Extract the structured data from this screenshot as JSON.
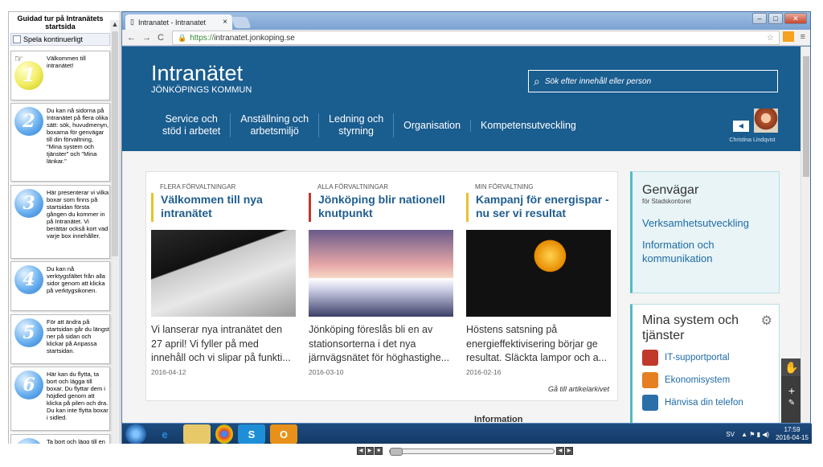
{
  "tour": {
    "title": "Guidad tur på Intranätets startsida",
    "loop_label": "Spela kontinuerligt",
    "steps": [
      {
        "num": "1",
        "text": "Välkommen till intranätet!"
      },
      {
        "num": "2",
        "text": "Du kan nå sidorna på Intranätet på flera olika sätt: sök, huvudmenyn, boxarna för genvägar till din förvaltning, \"Mina system och tjänster\" och \"Mina länkar.\""
      },
      {
        "num": "3",
        "text": "Här presenterar vi vilka boxar som finns på startsidan första gången du kommer in på Intranätet. Vi berättar också kort vad varje box innehåller."
      },
      {
        "num": "4",
        "text": "Du kan nå verktygsfältet från alla sidor genom att klicka på verktygsikonen."
      },
      {
        "num": "5",
        "text": "För att ändra på startsidan går du längst ner på sidan och klickar på Anpassa startsidan."
      },
      {
        "num": "6",
        "text": "Här kan du flytta, ta bort och lägga till boxar. Du flyttar dem i höjdled genom att klicka på pilen och dra. Du kan inte flytta boxar i sidled."
      },
      {
        "num": "7",
        "text": "Ta bort och lägg till en modul."
      }
    ]
  },
  "browser": {
    "tab_title": "Intranatet - Intranatet",
    "tab_close": "×",
    "url_scheme": "https://",
    "url_host": "intranatet.jonkoping.se",
    "win_min": "–",
    "win_restore": "□",
    "win_close": "✕",
    "back": "←",
    "forward": "→",
    "reload": "C",
    "menu": "≡",
    "star": "☆"
  },
  "site": {
    "logo_main": "Intranätet",
    "logo_sub": "JÖNKÖPINGS KOMMUN",
    "search_placeholder": "Sök efter innehåll eller person",
    "nav": [
      "Service och\nstöd i arbetet",
      "Anställning och\narbetsmiljö",
      "Ledning och\nstyrning",
      "Organisation",
      "Kompetensutveckling"
    ],
    "user_name": "Christina Lindqvist",
    "articles": [
      {
        "cat": "FLERA FÖRVALTNINGAR",
        "title": "Välkommen till nya intranätet",
        "excerpt": "Vi lanserar nya intranätet den 27 april! Vi fyller på med innehåll och vi slipar på funkti...",
        "date": "2016-04-12"
      },
      {
        "cat": "ALLA FÖRVALTNINGAR",
        "title": "Jönköping blir nationell knutpunkt",
        "excerpt": "Jönköping föreslås bli en av stationsorterna i det nya järnvägsnätet för höghastighe...",
        "date": "2016-03-10"
      },
      {
        "cat": "MIN FÖRVALTNING",
        "title": "Kampanj för energispar - nu ser vi resultat",
        "excerpt": "Höstens satsning på energieffektivisering börjar ge resultat. Släckta lampor och a...",
        "date": "2016-02-16"
      }
    ],
    "archive_link": "Gå till artikelarkivet",
    "genvagar": {
      "title": "Genvägar",
      "sub": "för Stadskontoret",
      "links": [
        "Verksamhetsutveckling",
        "Information och kommunikation"
      ]
    },
    "mina": {
      "title": "Mina system och tjänster",
      "items": [
        "IT-supportportal",
        "Ekonomisystem",
        "Hänvisa din telefon"
      ]
    },
    "info_heading": "Information"
  },
  "taskbar": {
    "lang": "SV",
    "time": "17:59",
    "date": "2016-04-15"
  },
  "colors": {
    "header": "#1a5d8f",
    "accent_yellow": "#e8c12e",
    "link": "#1f6ba6"
  }
}
